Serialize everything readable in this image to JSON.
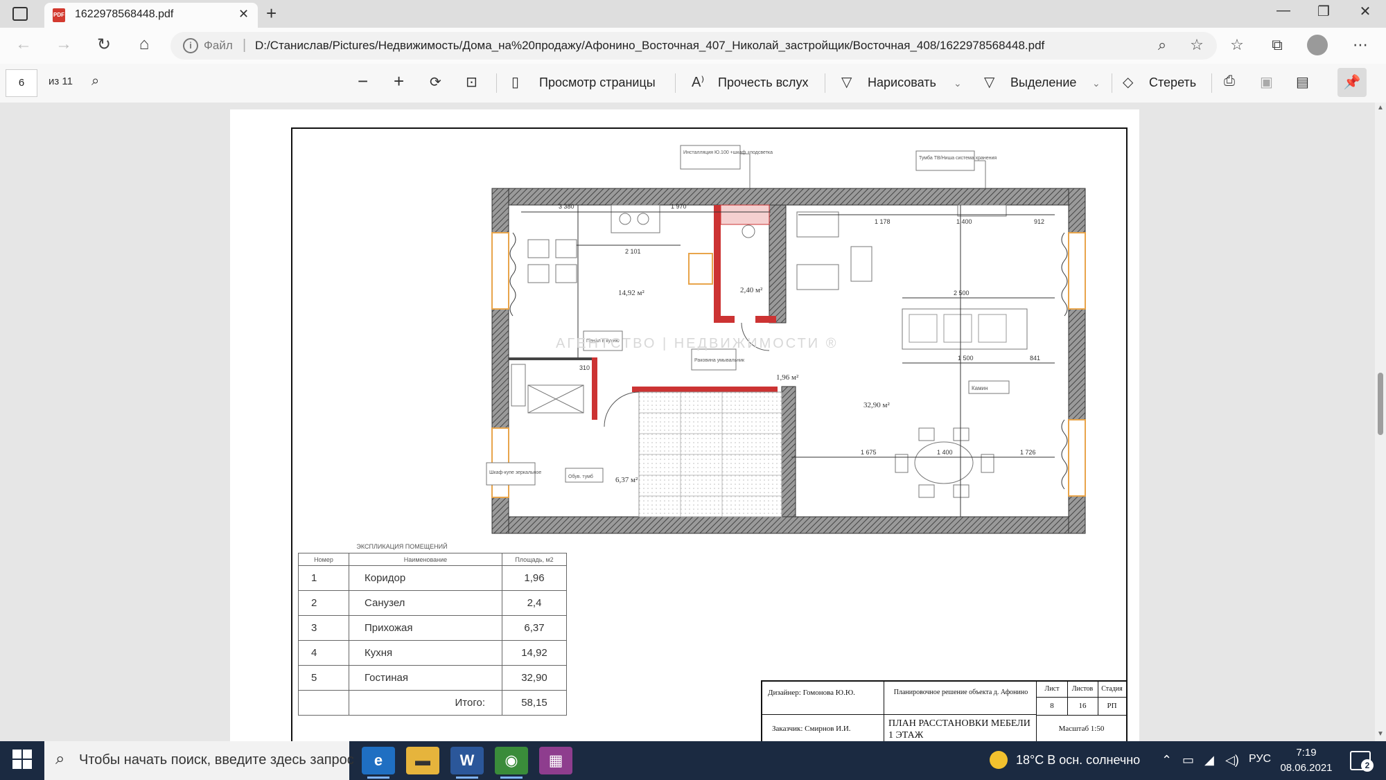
{
  "browser": {
    "tab_title": "1622978568448.pdf",
    "file_label": "Файл",
    "url": "D:/Станислав/Pictures/Недвижимость/Дома_на%20продажу/Афонино_Восточная_407_Николай_застройщик/Восточная_408/1622978568448.pdf"
  },
  "toolbar": {
    "page_number": "6",
    "page_count": "из 11",
    "page_view": "Просмотр страницы",
    "read_aloud": "Прочесть вслух",
    "draw": "Нарисовать",
    "highlight": "Выделение",
    "erase": "Стереть"
  },
  "plan": {
    "callouts": {
      "install": "Инсталляция Ю.100 +шкаф +подсветка",
      "tv": "Тумба ТВ/Ниша система хранения",
      "wardrobe": "Шкаф-купе зеркальное",
      "shoe": "Обув. тумб",
      "pantry": "Пенал в кухню",
      "sink": "Раковина умывальник",
      "sofa": "Камин"
    },
    "areas": {
      "kitchen": "14,92 м²",
      "bath": "2,40 м²",
      "corridor": "1,96 м²",
      "living": "32,90 м²",
      "hall": "6,37 м²"
    },
    "dims": {
      "top1": "3 380",
      "top2": "1 970",
      "k1": "2 101",
      "lv1": "1 178",
      "lv2": "1 400",
      "lv3": "912",
      "lv4": "1 500",
      "lv5": "841",
      "lv6": "1 675",
      "lv7": "1 400",
      "lv8": "1 726",
      "lv9": "2 500",
      "k2": "310"
    },
    "watermark": "АГЕНТСТВО | НЕДВИЖИМОСТИ ®"
  },
  "rooms_table": {
    "title": "ЭКСПЛИКАЦИЯ ПОМЕЩЕНИЙ",
    "headers": [
      "Номер",
      "Наименование",
      "Площадь, м2"
    ],
    "rows": [
      [
        "1",
        "Коридор",
        "1,96"
      ],
      [
        "2",
        "Санузел",
        "2,4"
      ],
      [
        "3",
        "Прихожая",
        "6,37"
      ],
      [
        "4",
        "Кухня",
        "14,92"
      ],
      [
        "5",
        "Гостиная",
        "32,90"
      ]
    ],
    "total_label": "Итого:",
    "total_value": "58,15"
  },
  "stamp": {
    "designer": "Дизайнер: Гомонова Ю.Ю.",
    "project": "Планировочное решение объекта д. Афонино",
    "customer": "Заказчик: Смирнов И.И.",
    "title": "ПЛАН РАССТАНОВКИ МЕБЕЛИ 1 ЭТАЖ",
    "sheet_label": "Лист",
    "sheets_label": "Листов",
    "stage_label": "Стадия",
    "sheet": "8",
    "sheets": "16",
    "stage": "РП",
    "scale": "Масштаб 1:50"
  },
  "taskbar": {
    "search_placeholder": "Чтобы начать поиск, введите здесь запрос",
    "weather": "18°C  В осн. солнечно",
    "lang": "РУС",
    "time": "7:19",
    "date": "08.06.2021",
    "notifications": "2"
  }
}
